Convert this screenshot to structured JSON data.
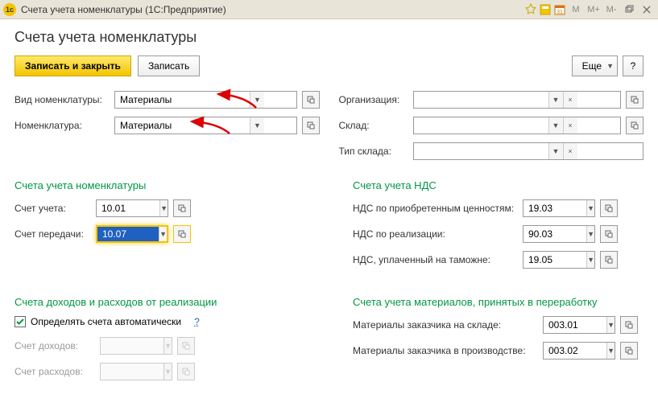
{
  "window": {
    "title": "Счета учета номенклатуры  (1С:Предприятие)"
  },
  "header": {
    "title": "Счета учета номенклатуры"
  },
  "toolbar": {
    "save_close": "Записать и закрыть",
    "save": "Записать",
    "more": "Еще",
    "help": "?"
  },
  "top_fields": {
    "nom_type_label": "Вид номенклатуры:",
    "nom_type_value": "Материалы",
    "nom_label": "Номенклатура:",
    "nom_value": "Материалы",
    "org_label": "Организация:",
    "org_value": "",
    "sklad_label": "Склад:",
    "sklad_value": "",
    "sklad_type_label": "Тип склада:",
    "sklad_type_value": ""
  },
  "section_accounts": {
    "title": "Счета учета номенклатуры",
    "account_label": "Счет учета:",
    "account_value": "10.01",
    "transfer_label": "Счет передачи:",
    "transfer_value": "10.07"
  },
  "section_vat": {
    "title": "Счета учета НДС",
    "purchased_label": "НДС по приобретенным ценностям:",
    "purchased_value": "19.03",
    "sales_label": "НДС по реализации:",
    "sales_value": "90.03",
    "customs_label": "НДС, уплаченный на таможне:",
    "customs_value": "19.05"
  },
  "section_income": {
    "title": "Счета доходов и расходов от реализации",
    "auto_label": "Определять счета автоматически",
    "help": "?",
    "income_label": "Счет доходов:",
    "income_value": "",
    "expense_label": "Счет расходов:",
    "expense_value": ""
  },
  "section_materials": {
    "title": "Счета учета материалов, принятых в переработку",
    "stock_label": "Материалы заказчика на складе:",
    "stock_value": "003.01",
    "prod_label": "Материалы заказчика в производстве:",
    "prod_value": "003.02"
  }
}
